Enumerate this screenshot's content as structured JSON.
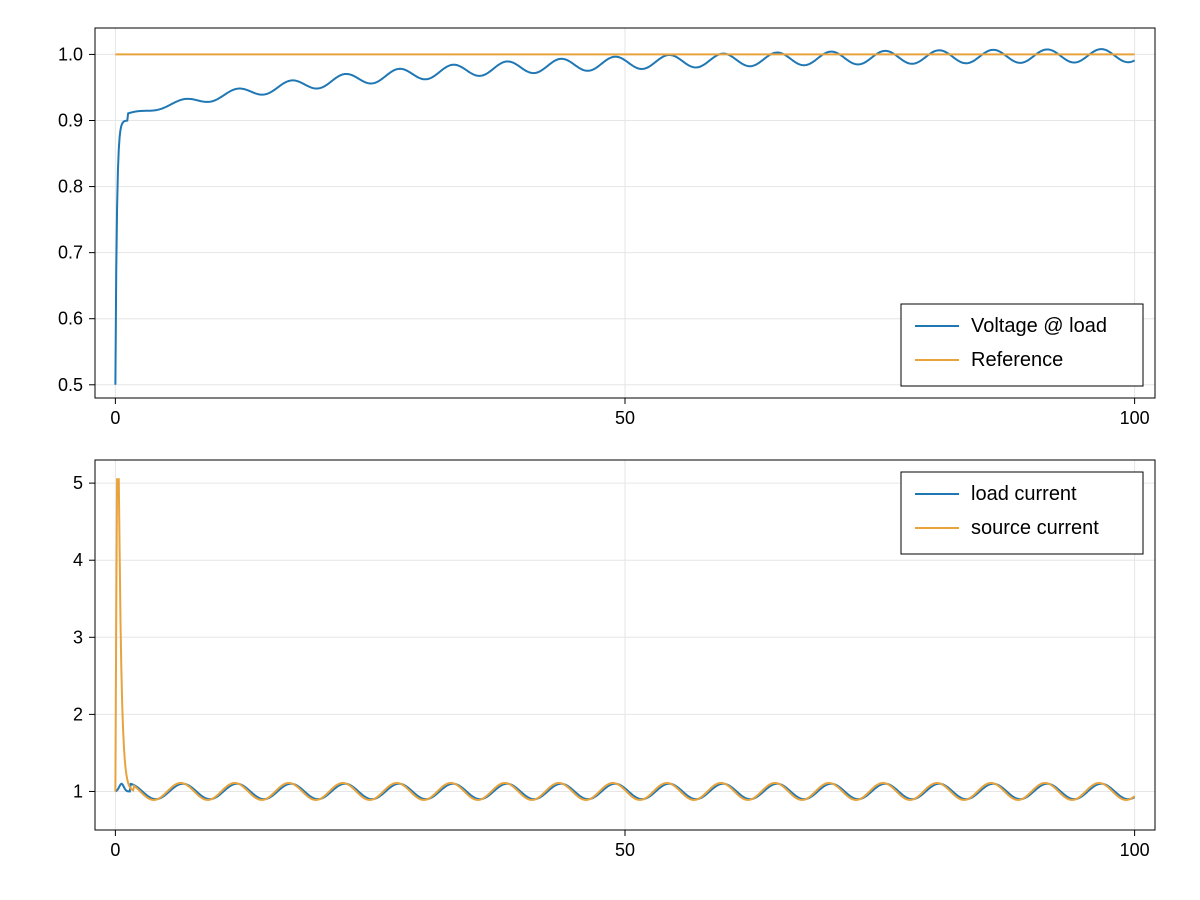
{
  "chart_data": [
    {
      "type": "line",
      "title": "",
      "xlabel": "",
      "ylabel": "",
      "xlim": [
        -2,
        102
      ],
      "ylim": [
        0.48,
        1.04
      ],
      "xticks": [
        0,
        50,
        100
      ],
      "yticks": [
        0.5,
        0.6,
        0.7,
        0.8,
        0.9,
        1.0
      ],
      "legend_pos": "lower-right",
      "series": [
        {
          "name": "Voltage @ load",
          "color": "#1f77b4",
          "fn": "voltage_load"
        },
        {
          "name": "Reference",
          "color": "#e8a33d",
          "fn": "reference_one"
        }
      ]
    },
    {
      "type": "line",
      "title": "",
      "xlabel": "",
      "ylabel": "",
      "xlim": [
        -2,
        102
      ],
      "ylim": [
        0.5,
        5.3
      ],
      "xticks": [
        0,
        50,
        100
      ],
      "yticks": [
        1,
        2,
        3,
        4,
        5
      ],
      "legend_pos": "upper-right",
      "series": [
        {
          "name": "load current",
          "color": "#1f77b4",
          "fn": "load_current"
        },
        {
          "name": "source current",
          "color": "#e8a33d",
          "fn": "source_current"
        }
      ]
    }
  ],
  "colors": {
    "blue": "#1f77b4",
    "orange": "#e8a33d",
    "grid": "#e6e6e6",
    "axis": "#000000"
  }
}
